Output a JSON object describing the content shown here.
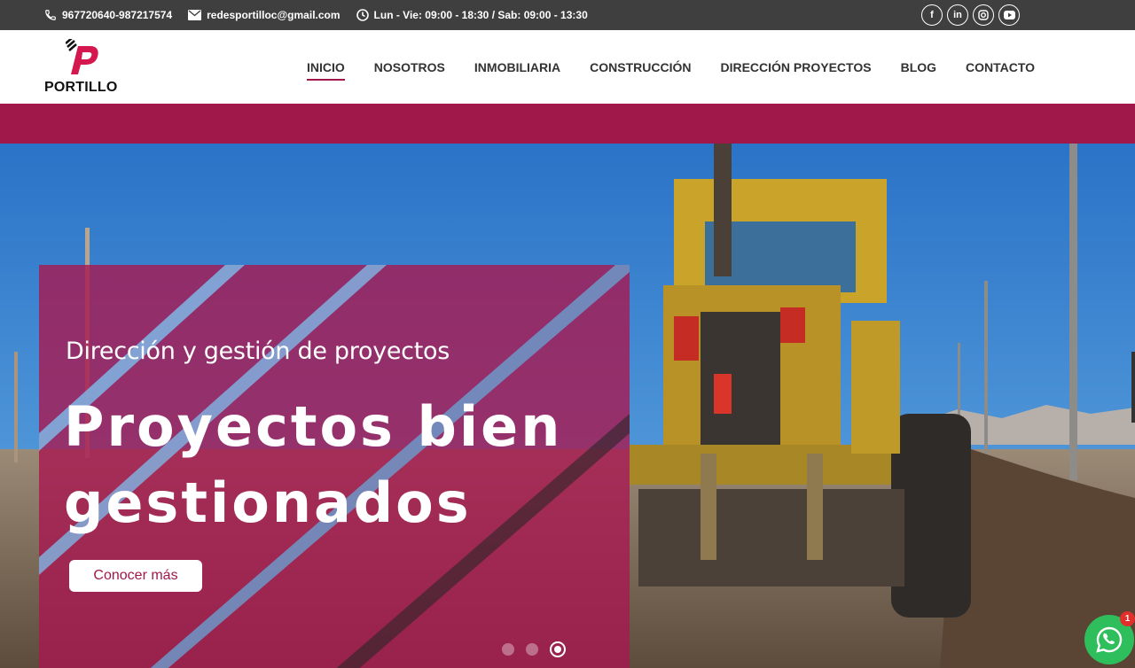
{
  "topbar": {
    "phone": "967720640-987217574",
    "email": "redesportilloc@gmail.com",
    "hours": "Lun - Vie: 09:00 - 18:30 / Sab: 09:00 - 13:30",
    "social": [
      "facebook-icon",
      "linkedin-icon",
      "instagram-icon",
      "youtube-icon"
    ]
  },
  "logo": {
    "text": "PORTILLO"
  },
  "nav": {
    "items": [
      {
        "label": "INICIO",
        "active": true
      },
      {
        "label": "NOSOTROS"
      },
      {
        "label": "INMOBILIARIA"
      },
      {
        "label": "CONSTRUCCIÓN"
      },
      {
        "label": "DIRECCIÓN PROYECTOS"
      },
      {
        "label": "BLOG"
      },
      {
        "label": "CONTACTO"
      }
    ]
  },
  "hero": {
    "subtitle": "Dirección y gestión de proyectos",
    "title": "Proyectos bien gestionados",
    "cta_label": "Conocer más",
    "slides": 3,
    "active_slide": 3
  },
  "whatsapp": {
    "badge": "1"
  },
  "colors": {
    "brand": "#a0174a",
    "topbar": "#3f3f3f",
    "whatsapp": "#2fbe5c"
  }
}
